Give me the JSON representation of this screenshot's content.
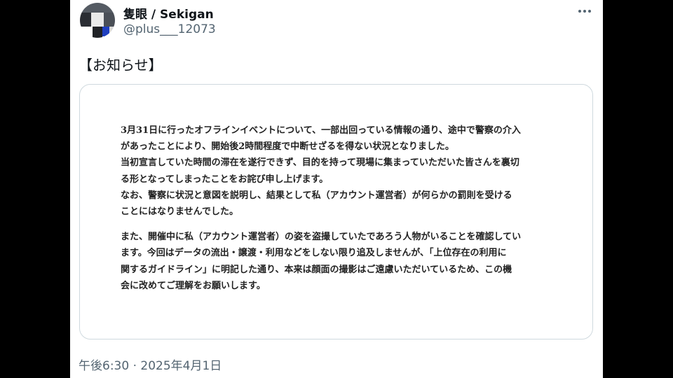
{
  "tweet": {
    "author": {
      "display_name": "隻眼 / Sekigan",
      "handle": "@plus___12073",
      "avatar": "avatar-image"
    },
    "more_icon": "more-horizontal-icon",
    "text": "【お知らせ】",
    "media": {
      "paragraph_1": "3月31日に行ったオフラインイベントについて、一部出回っている情報の通り、途中で警察の介入\nがあったことにより、開始後2時間程度で中断せざるを得ない状況となりました。\n当初宣言していた時間の滞在を遂行できず、目的を持って現場に集まっていただいた皆さんを裏切\nる形となってしまったことをお詫び申し上げます。\nなお、警察に状況と意図を説明し、結果として私（アカウント運営者）が何らかの罰則を受ける\nことにはなりませんでした。",
      "paragraph_2": "また、開催中に私（アカウント運営者）の姿を盗撮していたであろう人物がいることを確認してい\nます。今回はデータの流出・譲渡・利用などをしない限り追及しませんが、「上位存在の利用に\n関するガイドライン」に明記した通り、本来は顔面の撮影はご遠慮いただいているため、この機\n会に改めてご理解をお願いします。"
    },
    "timestamp": "午後6:30 · 2025年4月1日"
  },
  "colors": {
    "background": "#000000",
    "card": "#ffffff",
    "primary_text": "#0f1419",
    "secondary_text": "#536471",
    "border": "#cfd9de"
  }
}
